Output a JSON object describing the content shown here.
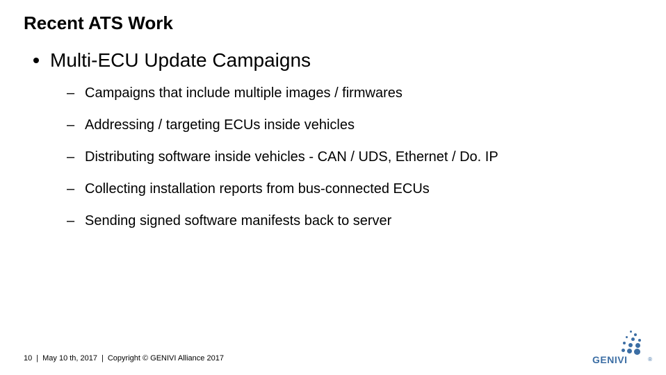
{
  "title": "Recent ATS Work",
  "main_bullet": "Multi-ECU Update Campaigns",
  "sub_bullets": {
    "b0": "Campaigns that include multiple images / firmwares",
    "b1": "Addressing / targeting ECUs inside vehicles",
    "b2": "Distributing software inside vehicles - CAN / UDS, Ethernet / Do. IP",
    "b3": "Collecting installation reports from bus-connected ECUs",
    "b4": "Sending signed software manifests back to server"
  },
  "footer": {
    "page": "10",
    "sep": "|",
    "date": "May 10 th, 2017",
    "copyright": "Copyright © GENIVI Alliance 2017"
  },
  "logo": {
    "text": "GENIVI",
    "reg": "®"
  }
}
